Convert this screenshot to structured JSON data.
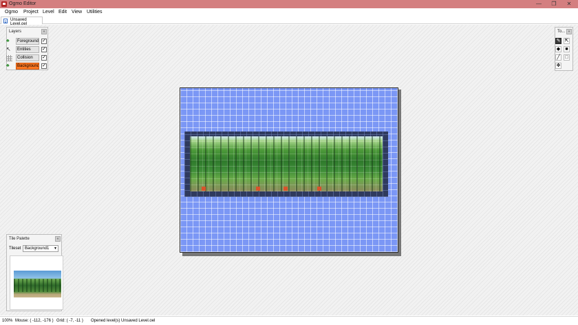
{
  "window": {
    "title": "Ogmo Editor",
    "controls": [
      "—",
      "❐",
      "✕"
    ]
  },
  "menu": [
    "Ogmo",
    "Project",
    "Level",
    "Edit",
    "View",
    "Utilities"
  ],
  "tab": {
    "label": "Unsaved Level.oel"
  },
  "layers_panel": {
    "title": "Layers",
    "close": "«",
    "layers": [
      {
        "name": "Foreground",
        "icon": "tree-icon",
        "visible": "✓",
        "selected": false
      },
      {
        "name": "Entities",
        "icon": "cursor-icon",
        "visible": "✓",
        "selected": false
      },
      {
        "name": "Collision",
        "icon": "grid-icon",
        "visible": "✓",
        "selected": false
      },
      {
        "name": "Background",
        "icon": "tree-icon",
        "visible": "✓",
        "selected": true
      }
    ]
  },
  "tools_panel": {
    "title": "To...",
    "close": "«",
    "tools": [
      {
        "name": "pencil",
        "glyph": "✎"
      },
      {
        "name": "eraser",
        "glyph": "⇱"
      },
      {
        "name": "fill",
        "glyph": "◆"
      },
      {
        "name": "rectangle",
        "glyph": "■"
      },
      {
        "name": "line",
        "glyph": "╱"
      },
      {
        "name": "rect-erase",
        "glyph": "□"
      },
      {
        "name": "move",
        "glyph": "✥"
      }
    ]
  },
  "tile_palette": {
    "title": "Tile Palette",
    "close": "«",
    "tileset_label": "Tileset",
    "tileset_value": "Background1",
    "tileset_arrow": "▼"
  },
  "status": {
    "zoom": "100%",
    "mouse": "Mouse: ( -112, -176 )",
    "grid": "Grid: ( -7, -11 )",
    "message": "Opened level(s) Unsaved Level.oel"
  },
  "colors": {
    "titlebar": "#d47f80",
    "level_bg": "#7b97f5",
    "selected_layer": "#ff7722",
    "marker": "#d9532b"
  }
}
